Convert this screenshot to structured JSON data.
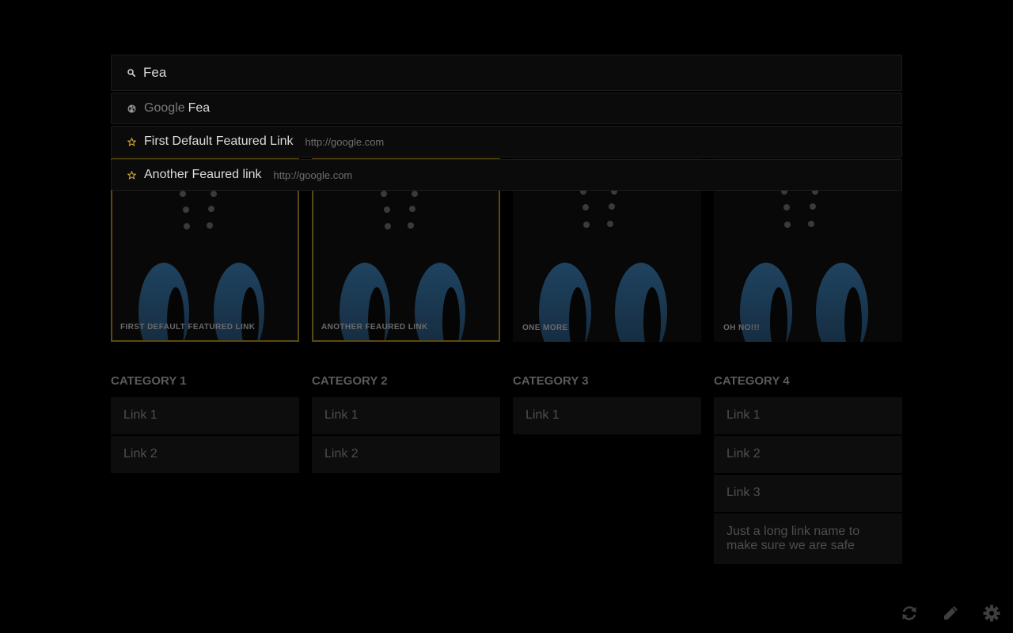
{
  "search": {
    "value": "Fea",
    "icon": "search-icon"
  },
  "suggestions": [
    {
      "type": "search",
      "icon": "globe-icon",
      "engine": "Google",
      "text": "Fea"
    },
    {
      "type": "featured",
      "icon": "star-icon",
      "text": "First Default Featured Link",
      "url": "http://google.com"
    },
    {
      "type": "featured",
      "icon": "star-icon",
      "text": "Another Feaured link",
      "url": "http://google.com"
    }
  ],
  "featured": [
    {
      "label": "FIRST DEFAULT FEATURED LINK",
      "highlighted": true
    },
    {
      "label": "ANOTHER FEAURED LINK",
      "highlighted": true
    },
    {
      "label": "ONE MORE",
      "highlighted": false
    },
    {
      "label": "OH NO!!!",
      "highlighted": false
    }
  ],
  "categories": [
    {
      "title": "CATEGORY 1",
      "links": [
        "Link 1",
        "Link 2"
      ]
    },
    {
      "title": "CATEGORY 2",
      "links": [
        "Link 1",
        "Link 2"
      ]
    },
    {
      "title": "CATEGORY 3",
      "links": [
        "Link 1"
      ]
    },
    {
      "title": "CATEGORY 4",
      "links": [
        "Link 1",
        "Link 2",
        "Link 3",
        "Just a long link name to make sure we are safe"
      ]
    }
  ],
  "toolbar": {
    "icons": [
      "refresh-icon",
      "pencil-icon",
      "gear-icon"
    ]
  },
  "colors": {
    "background": "#000000",
    "highlight_border": "#5a4a12",
    "star": "#e0b43a",
    "blob": "#1d3a54"
  }
}
